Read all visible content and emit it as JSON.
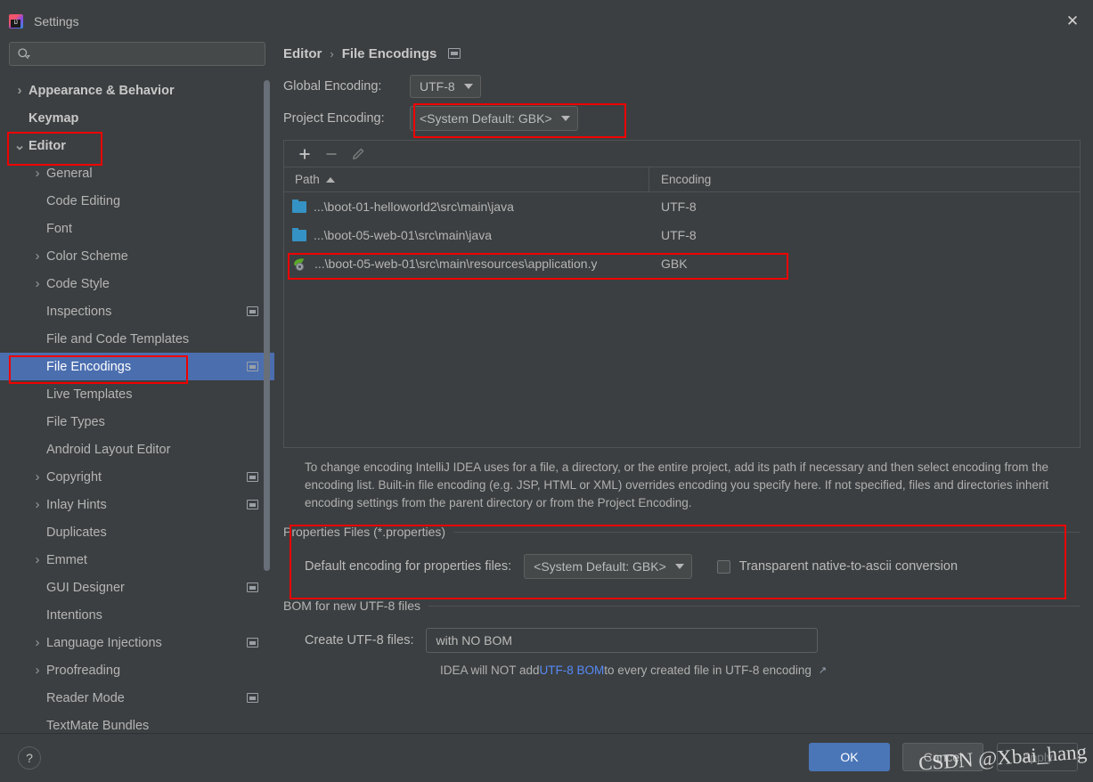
{
  "window": {
    "title": "Settings",
    "app_icon": "intellij-idea-icon",
    "close_label": "✕"
  },
  "sidebar": {
    "search": {
      "value": "",
      "placeholder": "",
      "icon": "search-icon"
    },
    "items": [
      {
        "label": "Appearance & Behavior",
        "level": 1,
        "arrow": "collapsed",
        "bold": true,
        "badge": false,
        "selected": false
      },
      {
        "label": "Keymap",
        "level": 1,
        "arrow": "none",
        "bold": true,
        "badge": false,
        "selected": false
      },
      {
        "label": "Editor",
        "level": 1,
        "arrow": "expanded",
        "bold": true,
        "badge": false,
        "selected": false
      },
      {
        "label": "General",
        "level": 2,
        "arrow": "collapsed",
        "bold": false,
        "badge": false,
        "selected": false
      },
      {
        "label": "Code Editing",
        "level": 2,
        "arrow": "none",
        "bold": false,
        "badge": false,
        "selected": false
      },
      {
        "label": "Font",
        "level": 2,
        "arrow": "none",
        "bold": false,
        "badge": false,
        "selected": false
      },
      {
        "label": "Color Scheme",
        "level": 2,
        "arrow": "collapsed",
        "bold": false,
        "badge": false,
        "selected": false
      },
      {
        "label": "Code Style",
        "level": 2,
        "arrow": "collapsed",
        "bold": false,
        "badge": false,
        "selected": false
      },
      {
        "label": "Inspections",
        "level": 2,
        "arrow": "none",
        "bold": false,
        "badge": true,
        "selected": false
      },
      {
        "label": "File and Code Templates",
        "level": 2,
        "arrow": "none",
        "bold": false,
        "badge": false,
        "selected": false
      },
      {
        "label": "File Encodings",
        "level": 2,
        "arrow": "none",
        "bold": false,
        "badge": true,
        "selected": true
      },
      {
        "label": "Live Templates",
        "level": 2,
        "arrow": "none",
        "bold": false,
        "badge": false,
        "selected": false
      },
      {
        "label": "File Types",
        "level": 2,
        "arrow": "none",
        "bold": false,
        "badge": false,
        "selected": false
      },
      {
        "label": "Android Layout Editor",
        "level": 2,
        "arrow": "none",
        "bold": false,
        "badge": false,
        "selected": false
      },
      {
        "label": "Copyright",
        "level": 2,
        "arrow": "collapsed",
        "bold": false,
        "badge": true,
        "selected": false
      },
      {
        "label": "Inlay Hints",
        "level": 2,
        "arrow": "collapsed",
        "bold": false,
        "badge": true,
        "selected": false
      },
      {
        "label": "Duplicates",
        "level": 2,
        "arrow": "none",
        "bold": false,
        "badge": false,
        "selected": false
      },
      {
        "label": "Emmet",
        "level": 2,
        "arrow": "collapsed",
        "bold": false,
        "badge": false,
        "selected": false
      },
      {
        "label": "GUI Designer",
        "level": 2,
        "arrow": "none",
        "bold": false,
        "badge": true,
        "selected": false
      },
      {
        "label": "Intentions",
        "level": 2,
        "arrow": "none",
        "bold": false,
        "badge": false,
        "selected": false
      },
      {
        "label": "Language Injections",
        "level": 2,
        "arrow": "collapsed",
        "bold": false,
        "badge": true,
        "selected": false
      },
      {
        "label": "Proofreading",
        "level": 2,
        "arrow": "collapsed",
        "bold": false,
        "badge": false,
        "selected": false
      },
      {
        "label": "Reader Mode",
        "level": 2,
        "arrow": "none",
        "bold": false,
        "badge": true,
        "selected": false
      },
      {
        "label": "TextMate Bundles",
        "level": 2,
        "arrow": "none",
        "bold": false,
        "badge": false,
        "selected": false
      }
    ]
  },
  "main": {
    "breadcrumb": {
      "parent": "Editor",
      "separator": "›",
      "current": "File Encodings"
    },
    "global_encoding": {
      "label": "Global Encoding:",
      "value": "UTF-8"
    },
    "project_encoding": {
      "label": "Project Encoding:",
      "value": "<System Default: GBK>"
    },
    "toolbar": {
      "add": "+",
      "remove": "−",
      "edit": "pencil-icon"
    },
    "table": {
      "columns": [
        "Path",
        "Encoding"
      ],
      "sort": "Path ascending",
      "rows": [
        {
          "icon": "folder-icon",
          "path": "...\\boot-01-helloworld2\\src\\main\\java",
          "encoding": "UTF-8"
        },
        {
          "icon": "folder-icon",
          "path": "...\\boot-05-web-01\\src\\main\\java",
          "encoding": "UTF-8"
        },
        {
          "icon": "spring-yaml-icon",
          "path": "...\\boot-05-web-01\\src\\main\\resources\\application.y",
          "encoding": "GBK"
        }
      ]
    },
    "description": "To change encoding IntelliJ IDEA uses for a file, a directory, or the entire project, add its path if necessary and then select encoding from the encoding list. Built-in file encoding (e.g. JSP, HTML or XML) overrides encoding you specify here. If not specified, files and directories inherit encoding settings from the parent directory or from the Project Encoding.",
    "properties_group": {
      "title": "Properties Files (*.properties)",
      "default_encoding_label": "Default encoding for properties files:",
      "default_encoding_value": "<System Default: GBK>",
      "transparent_label": "Transparent native-to-ascii conversion",
      "transparent_checked": false
    },
    "bom_group": {
      "title": "BOM for new UTF-8 files",
      "create_label": "Create UTF-8 files:",
      "create_value": "with NO BOM",
      "hint_prefix": "IDEA will NOT add ",
      "hint_link": "UTF-8 BOM",
      "hint_suffix": " to every created file in UTF-8 encoding",
      "external_link_icon": "↗"
    }
  },
  "footer": {
    "help": "?",
    "ok": "OK",
    "cancel": "Cancel",
    "apply": "Apply"
  },
  "watermark": "CSDN @Xbai_hang",
  "colors": {
    "background": "#3c3f41",
    "selection": "#4b6eaf",
    "accent_button": "#4a76b8",
    "annotation_red": "#f00000",
    "link_blue": "#548af7",
    "folder_blue": "#3592c4"
  }
}
